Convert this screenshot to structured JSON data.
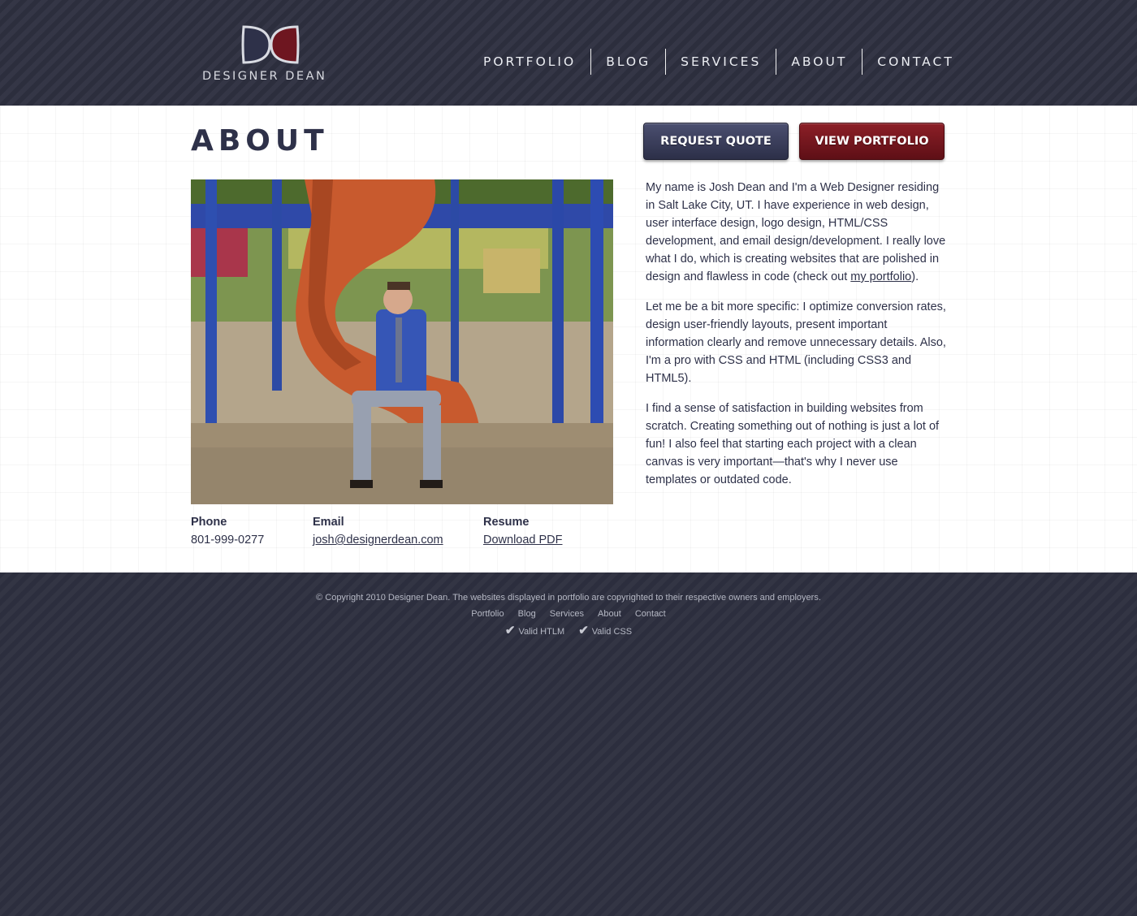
{
  "brand": {
    "logo_text": "DESIGNER DEAN"
  },
  "nav": {
    "items": [
      "PORTFOLIO",
      "BLOG",
      "SERVICES",
      "ABOUT",
      "CONTACT"
    ]
  },
  "page": {
    "title": "ABOUT"
  },
  "buttons": {
    "request_quote": "REQUEST QUOTE",
    "view_portfolio": "VIEW PORTFOLIO"
  },
  "contact": {
    "phone_label": "Phone",
    "phone": "801-999-0277",
    "email_label": "Email",
    "email": "josh@designerdean.com",
    "resume_label": "Resume",
    "resume_link": "Download PDF"
  },
  "bio": {
    "p1_text": "My name is Josh Dean and I'm a Web Designer residing in Salt Lake City, UT. I have experience in web design, user interface design, logo design, HTML/CSS development, and email design/development. I really love what I do, which is creating websites that are polished in design and flawless in code (check out ",
    "p1_link": "my portfolio",
    "p1_end": ").",
    "p2": "Let me be a bit more specific: I optimize conversion rates, design user-friendly layouts, present important information clearly and remove unnecessary details. Also, I'm a pro with CSS and HTML (including CSS3 and HTML5).",
    "p3": "I find a sense of satisfaction in building websites from scratch. Creating something out of nothing is just a lot of fun! I also feel that starting each project with a clean canvas is very important—that's why I never use templates or outdated code."
  },
  "footer": {
    "copyright": "© Copyright 2010 Designer Dean. The websites displayed in portfolio are copyrighted to their respective owners and employers.",
    "links": [
      "Portfolio",
      "Blog",
      "Services",
      "About",
      "Contact"
    ],
    "valid_html": "Valid HTLM",
    "valid_css": "Valid CSS"
  },
  "colors": {
    "navy": "#2e3149",
    "maroon": "#7a1520",
    "background": "#2e3040"
  }
}
